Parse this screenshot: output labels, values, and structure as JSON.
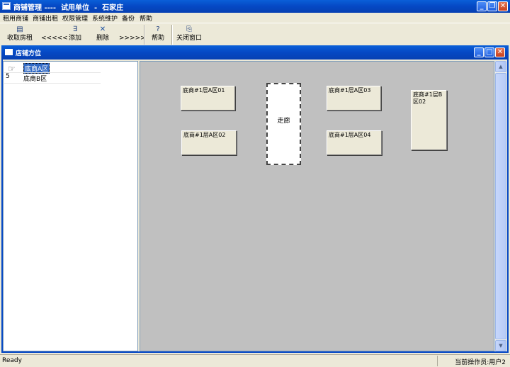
{
  "window": {
    "title": "商铺管理 ----  试用单位  -  石家庄"
  },
  "menu": [
    "租用商铺",
    "商铺出租",
    "权限管理",
    "系统维护",
    "备份",
    "帮助"
  ],
  "toolbar": {
    "collect_rent": "收取房租",
    "prev": "<<<<<",
    "add": "添加",
    "delete": "删除",
    "next": ">>>>>",
    "help": "帮助",
    "close_window": "关闭窗口"
  },
  "child_window": {
    "title": "店铺方位"
  },
  "tree": {
    "items": [
      "底商A区",
      "底商B区"
    ],
    "selected_index": 0,
    "count": "5"
  },
  "canvas": {
    "shops": [
      {
        "label": "底商#1层A区01"
      },
      {
        "label": "底商#1层A区02"
      },
      {
        "label": "底商#1层A区03"
      },
      {
        "label": "底商#1层A区04"
      },
      {
        "label": "底商#1层B区02"
      }
    ],
    "corridor": "走廊"
  },
  "status": {
    "left": "Ready",
    "right": "当前操作员:用户2"
  }
}
